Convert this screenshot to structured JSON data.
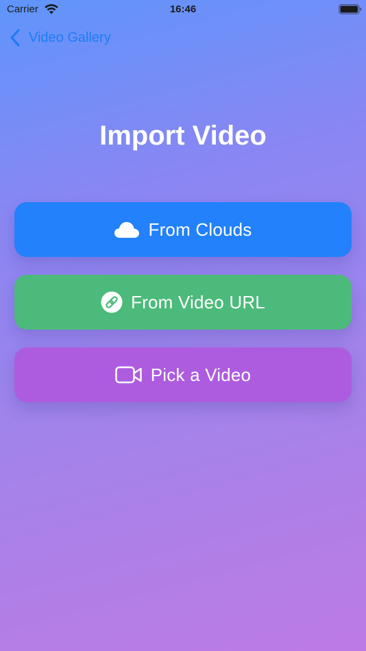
{
  "status_bar": {
    "carrier": "Carrier",
    "time": "16:46"
  },
  "nav": {
    "back_label": "Video Gallery"
  },
  "page": {
    "title": "Import Video"
  },
  "buttons": {
    "clouds": {
      "label": "From Clouds",
      "icon": "cloud-icon",
      "color": "#2281fb"
    },
    "url": {
      "label": "From Video URL",
      "icon": "link-icon",
      "color": "#4cba7a"
    },
    "pick": {
      "label": "Pick a Video",
      "icon": "video-camera-icon",
      "color": "#ad5ce0"
    }
  },
  "colors": {
    "nav_tint": "#1e7cf5",
    "background_top": "#5f95fb",
    "background_bottom": "#bd7ae6"
  }
}
